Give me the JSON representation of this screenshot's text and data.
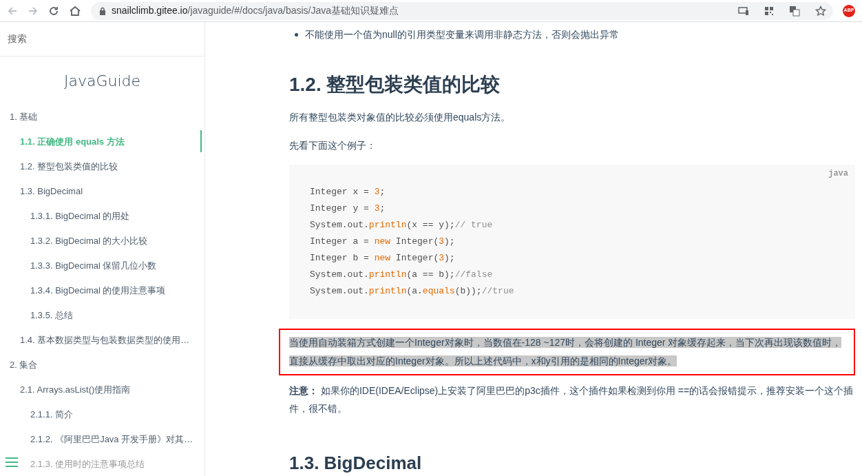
{
  "browser": {
    "url_host": "snailclimb.gitee.io",
    "url_path": "/javaguide/#/docs/java/basis/Java基础知识疑难点",
    "extension_badge": "ABP"
  },
  "sidebar": {
    "search_label": "搜索",
    "title": "JavaGuide",
    "items": [
      {
        "label": "1. 基础",
        "selected": false,
        "faded": false,
        "children": [
          {
            "label": "1.1. 正确使用 equals 方法",
            "selected": true,
            "faded": false
          },
          {
            "label": "1.2. 整型包装类值的比较",
            "selected": false,
            "faded": false
          },
          {
            "label": "1.3. BigDecimal",
            "selected": false,
            "faded": false,
            "children": [
              {
                "label": "1.3.1. BigDecimal 的用处",
                "selected": false,
                "faded": false
              },
              {
                "label": "1.3.2. BigDecimal 的大小比较",
                "selected": false,
                "faded": false
              },
              {
                "label": "1.3.3. BigDecimal 保留几位小数",
                "selected": false,
                "faded": false
              },
              {
                "label": "1.3.4. BigDecimal 的使用注意事项",
                "selected": false,
                "faded": false
              },
              {
                "label": "1.3.5. 总结",
                "selected": false,
                "faded": false
              }
            ]
          },
          {
            "label": "1.4. 基本数据类型与包装数据类型的使用…",
            "selected": false,
            "faded": false
          }
        ]
      },
      {
        "label": "2. 集合",
        "selected": false,
        "faded": false,
        "children": [
          {
            "label": "2.1. Arrays.asList()使用指南",
            "selected": false,
            "faded": false,
            "children": [
              {
                "label": "2.1.1. 简介",
                "selected": false,
                "faded": false
              },
              {
                "label": "2.1.2. 《阿里巴巴Java 开发手册》对其…",
                "selected": false,
                "faded": false
              },
              {
                "label": "2.1.3. 使用时的注意事项总结",
                "selected": false,
                "faded": true
              }
            ]
          }
        ]
      }
    ]
  },
  "content": {
    "bullet": "不能使用一个值为null的引用类型变量来调用非静态方法，否则会抛出异常",
    "heading": "1.2. 整型包装类值的比较",
    "paragraphs": [
      "所有整型包装类对象值的比较必须使用equals方法。",
      "先看下面这个例子："
    ],
    "code": {
      "lang": "java",
      "lines": [
        [
          {
            "kind": "plain",
            "text": "Integer x = "
          },
          {
            "kind": "number",
            "text": "3"
          },
          {
            "kind": "plain",
            "text": ";"
          }
        ],
        [
          {
            "kind": "plain",
            "text": "Integer y = "
          },
          {
            "kind": "number",
            "text": "3"
          },
          {
            "kind": "plain",
            "text": ";"
          }
        ],
        [
          {
            "kind": "plain",
            "text": "System.out."
          },
          {
            "kind": "function",
            "text": "println"
          },
          {
            "kind": "plain",
            "text": "(x == y);"
          },
          {
            "kind": "comment",
            "text": "// true"
          }
        ],
        [
          {
            "kind": "plain",
            "text": "Integer a = "
          },
          {
            "kind": "keyword",
            "text": "new"
          },
          {
            "kind": "plain",
            "text": " Integer("
          },
          {
            "kind": "number",
            "text": "3"
          },
          {
            "kind": "plain",
            "text": ");"
          }
        ],
        [
          {
            "kind": "plain",
            "text": "Integer b = "
          },
          {
            "kind": "keyword",
            "text": "new"
          },
          {
            "kind": "plain",
            "text": " Integer("
          },
          {
            "kind": "number",
            "text": "3"
          },
          {
            "kind": "plain",
            "text": ");"
          }
        ],
        [
          {
            "kind": "plain",
            "text": "System.out."
          },
          {
            "kind": "function",
            "text": "println"
          },
          {
            "kind": "plain",
            "text": "(a == b);"
          },
          {
            "kind": "comment",
            "text": "//false"
          }
        ],
        [
          {
            "kind": "plain",
            "text": "System.out."
          },
          {
            "kind": "function",
            "text": "println"
          },
          {
            "kind": "plain",
            "text": "(a."
          },
          {
            "kind": "function",
            "text": "equals"
          },
          {
            "kind": "plain",
            "text": "(b));"
          },
          {
            "kind": "comment",
            "text": "//true"
          }
        ]
      ]
    },
    "highlight": {
      "text": "当使用自动装箱方式创建一个Integer对象时，当数值在-128 ~127时，会将创建的 Integer 对象缓存起来，当下次再出现该数值时，直接从缓存中取出对应的Integer对象。所以上述代码中，x和y引用的是相同的Integer对象。",
      "selected": true
    },
    "note": "**注意：** 如果你的IDE(IDEA/Eclipse)上安装了阿里巴巴的p3c插件，这个插件如果检测到你用 ==的话会报错提示，推荐安装一个这个插件，很不错。",
    "next_heading": "1.3. BigDecimal"
  }
}
